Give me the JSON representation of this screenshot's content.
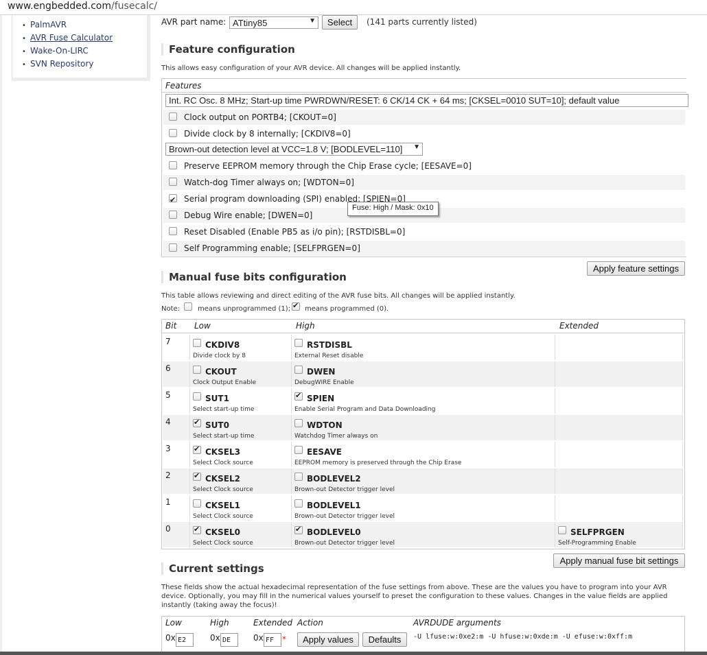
{
  "browser": {
    "url_host": "www.engbedded.com",
    "url_path": "/fusecalc/"
  },
  "sidebar": {
    "items": [
      {
        "label": "PalmAVR"
      },
      {
        "label": "AVR Fuse Calculator"
      },
      {
        "label": "Wake-On-LIRC"
      },
      {
        "label": "SVN Repository"
      }
    ]
  },
  "part": {
    "label": "AVR part name:",
    "selected": "ATtiny85",
    "select_button": "Select",
    "count_text": "(141 parts currently listed)"
  },
  "feature_config": {
    "heading": "Feature configuration",
    "description": "This allows easy configuration of your AVR device. All changes will be applied instantly.",
    "caption": "Features",
    "clock_select": "Int. RC Osc. 8 MHz; Start-up time PWRDWN/RESET: 6 CK/14 CK + 64 ms; [CKSEL=0010 SUT=10]; default value",
    "clock_output": {
      "label": "Clock output on PORTB4; [CKOUT=0]",
      "checked": false
    },
    "clock_div": {
      "label": "Divide clock by 8 internally; [CKDIV8=0]",
      "checked": false
    },
    "bod_select": "Brown-out detection level at VCC=1.8 V; [BODLEVEL=110]",
    "options": [
      {
        "label": "Preserve EEPROM memory through the Chip Erase cycle; [EESAVE=0]",
        "checked": false
      },
      {
        "label": "Watch-dog Timer always on; [WDTON=0]",
        "checked": false
      },
      {
        "label": "Serial program downloading (SPI) enabled; [SPIEN=0]",
        "checked": true
      },
      {
        "label": "Debug Wire enable; [DWEN=0]",
        "checked": false
      },
      {
        "label": "Reset Disabled (Enable PB5 as i/o pin); [RSTDISBL=0]",
        "checked": false
      },
      {
        "label": "Self Programming enable; [SELFPRGEN=0]",
        "checked": false
      }
    ],
    "tooltip": "Fuse: High / Mask: 0x10",
    "apply_button": "Apply feature settings"
  },
  "manual": {
    "heading": "Manual fuse bits configuration",
    "description": "This table allows reviewing and direct editing of the AVR fuse bits. All changes will be applied instantly.",
    "note_prefix": "Note:",
    "note_unprog": "means unprogrammed (1);",
    "note_prog": "means programmed (0).",
    "columns": {
      "bit": "Bit",
      "low": "Low",
      "high": "High",
      "extended": "Extended"
    },
    "rows": [
      {
        "bit": "7",
        "low": {
          "name": "CKDIV8",
          "desc": "Divide clock by 8",
          "on": false
        },
        "high": {
          "name": "RSTDISBL",
          "desc": "External Reset disable",
          "on": false
        }
      },
      {
        "bit": "6",
        "low": {
          "name": "CKOUT",
          "desc": "Clock Output Enable",
          "on": false
        },
        "high": {
          "name": "DWEN",
          "desc": "DebugWIRE Enable",
          "on": false
        }
      },
      {
        "bit": "5",
        "low": {
          "name": "SUT1",
          "desc": "Select start-up time",
          "on": false
        },
        "high": {
          "name": "SPIEN",
          "desc": "Enable Serial Program and Data Downloading",
          "on": true
        }
      },
      {
        "bit": "4",
        "low": {
          "name": "SUT0",
          "desc": "Select start-up time",
          "on": true
        },
        "high": {
          "name": "WDTON",
          "desc": "Watchdog Timer always on",
          "on": false
        }
      },
      {
        "bit": "3",
        "low": {
          "name": "CKSEL3",
          "desc": "Select Clock source",
          "on": true
        },
        "high": {
          "name": "EESAVE",
          "desc": "EEPROM memory is preserved through the Chip Erase",
          "on": false
        }
      },
      {
        "bit": "2",
        "low": {
          "name": "CKSEL2",
          "desc": "Select Clock source",
          "on": true
        },
        "high": {
          "name": "BODLEVEL2",
          "desc": "Brown-out Detector trigger level",
          "on": false
        }
      },
      {
        "bit": "1",
        "low": {
          "name": "CKSEL1",
          "desc": "Select Clock source",
          "on": false
        },
        "high": {
          "name": "BODLEVEL1",
          "desc": "Brown-out Detector trigger level",
          "on": false
        }
      },
      {
        "bit": "0",
        "low": {
          "name": "CKSEL0",
          "desc": "Select Clock source",
          "on": true
        },
        "high": {
          "name": "BODLEVEL0",
          "desc": "Brown-out Detector trigger level",
          "on": true
        },
        "extended": {
          "name": "SELFPRGEN",
          "desc": "Self-Programming Enable",
          "on": false
        }
      }
    ],
    "apply_button": "Apply manual fuse bit settings"
  },
  "current": {
    "heading": "Current settings",
    "description": "These fields show the actual hexadecimal representation of the fuse settings from above. These are the values you have to program into your AVR device. Optionally, you may fill in the numerical values yourself to preset the configuration to these values. Changes in the value fields are applied instantly (taking away the focus)!",
    "columns": {
      "low": "Low",
      "high": "High",
      "extended": "Extended",
      "action": "Action",
      "args": "AVRDUDE arguments"
    },
    "prefix": "0x",
    "low": "E2",
    "high": "DE",
    "extended": "FF",
    "star": "*",
    "apply_values_button": "Apply values",
    "defaults_button": "Defaults",
    "avrdude": "-U lfuse:w:0xe2:m -U hfuse:w:0xde:m -U efuse:w:0xff:m"
  }
}
